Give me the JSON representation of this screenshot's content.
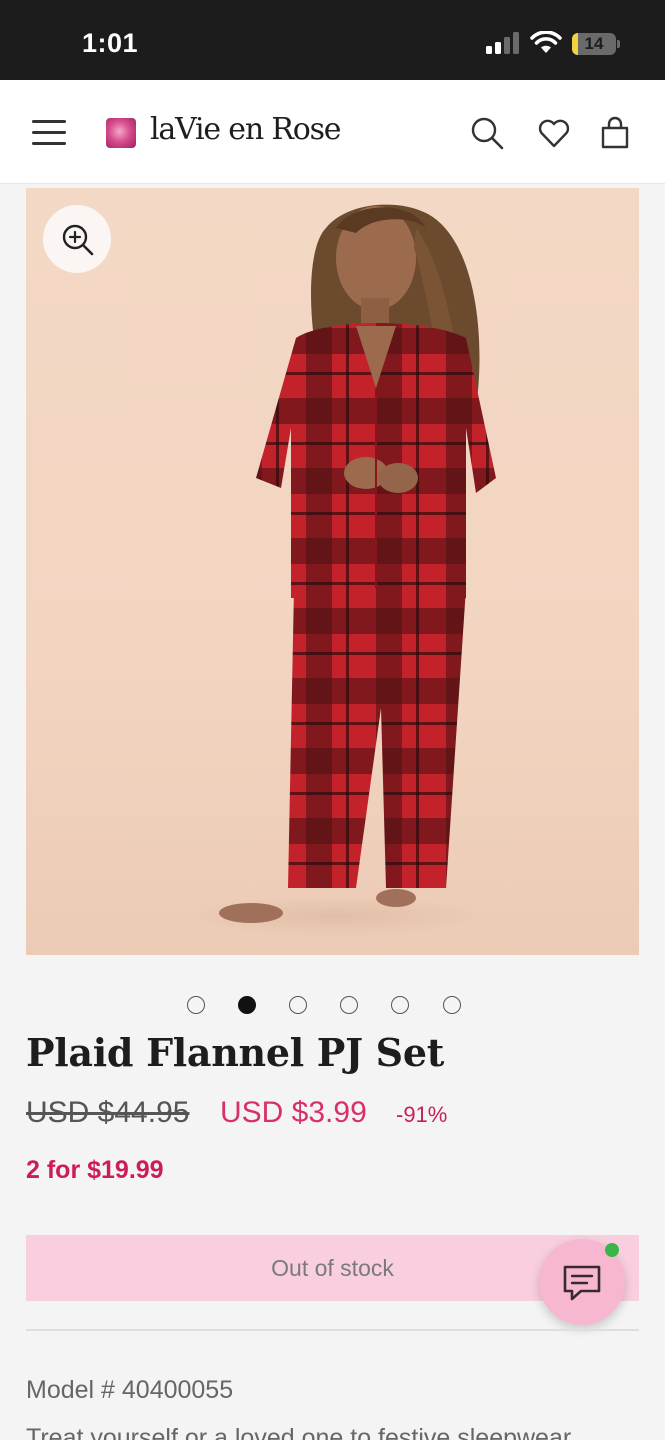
{
  "status_bar": {
    "time": "1:01",
    "battery_percent": "14",
    "battery_level": 0.14,
    "battery_color": "#f2d43d"
  },
  "header": {
    "menu_icon": "hamburger-menu-icon",
    "logo_icon": "rose-logo-icon",
    "logo_text": "laVie en Rose",
    "search_icon": "search-icon",
    "wishlist_icon": "heart-icon",
    "bag_icon": "shopping-bag-icon"
  },
  "gallery": {
    "zoom_icon": "zoom-in-icon",
    "total_images": 6,
    "active_index": 1
  },
  "product": {
    "title": "Plaid Flannel PJ Set",
    "original_price": "USD $44.95",
    "sale_price": "USD $3.99",
    "discount": "-91%",
    "promo": "2 for $19.99",
    "stock_status": "Out of stock",
    "model_number": "Model # 40400055",
    "description_preview": "Treat yourself or a loved one to festive sleepwear"
  },
  "chat": {
    "icon": "chat-icon",
    "online": true
  },
  "colors": {
    "accent": "#d8306b",
    "promo": "#cc1d55",
    "out_of_stock_bg": "#f9cfe0",
    "chat_bg": "#f7b7d1",
    "online_dot": "#3bb54a"
  }
}
